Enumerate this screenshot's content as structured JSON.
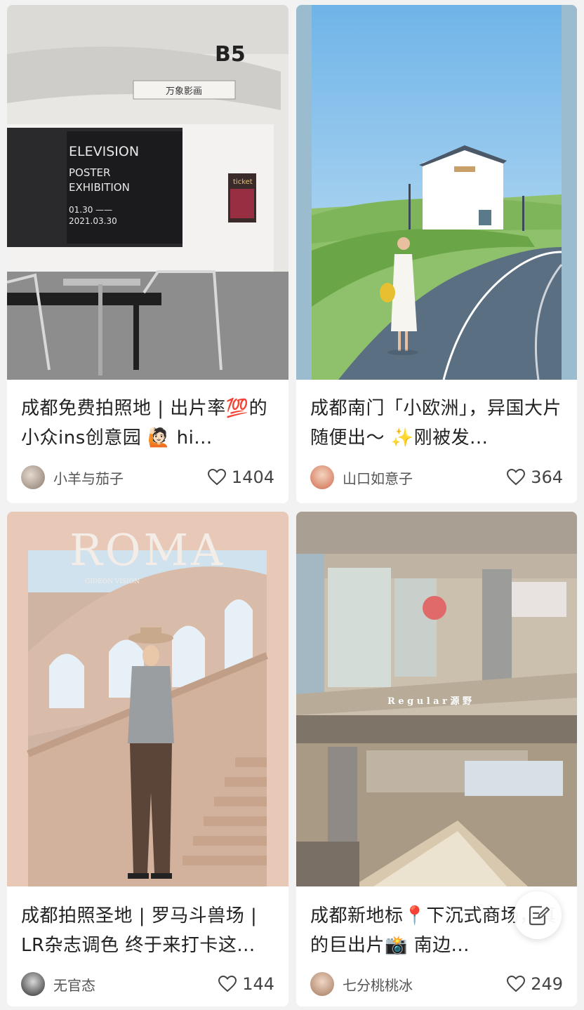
{
  "feed": {
    "cards": [
      {
        "title": "成都免费拍照地 | 出片率💯的小众ins创意园 🙋🏻 hi...",
        "author": "小羊与茄子",
        "likes": "1404",
        "cover_sign_b5": "B5",
        "cover_sign_brand": "万象影画",
        "cover_poster_line1": "ELEVISION",
        "cover_poster_line2": "POSTER",
        "cover_poster_line3": "EXHIBITION",
        "cover_poster_dates_1": "01.30 ——",
        "cover_poster_dates_2": "2021.03.30",
        "cover_ticket": "ticket"
      },
      {
        "title": "成都南门「小欧洲」，异国大片随便出～ ✨刚被发...",
        "author": "山口如意子",
        "likes": "364"
      },
      {
        "title": "成都拍照圣地 | 罗马斗兽场 | LR杂志调色 终于来打卡这...",
        "author": "无官态",
        "likes": "144",
        "cover_masthead": "ROMA",
        "cover_subtitle": "GIDEON VISION"
      },
      {
        "title": "成都新地标📍下沉式商场，真的巨出片📸 南边...",
        "author": "七分桃桃冰",
        "likes": "249",
        "cover_caption": "R e g u l a r  源 野"
      }
    ]
  },
  "colors": {
    "page_bg": "#f2f2f2",
    "card_bg": "#ffffff",
    "text_primary": "#222222",
    "text_secondary": "#555555"
  },
  "icons": {
    "like": "heart-outline-icon",
    "compose": "note-edit-icon"
  }
}
